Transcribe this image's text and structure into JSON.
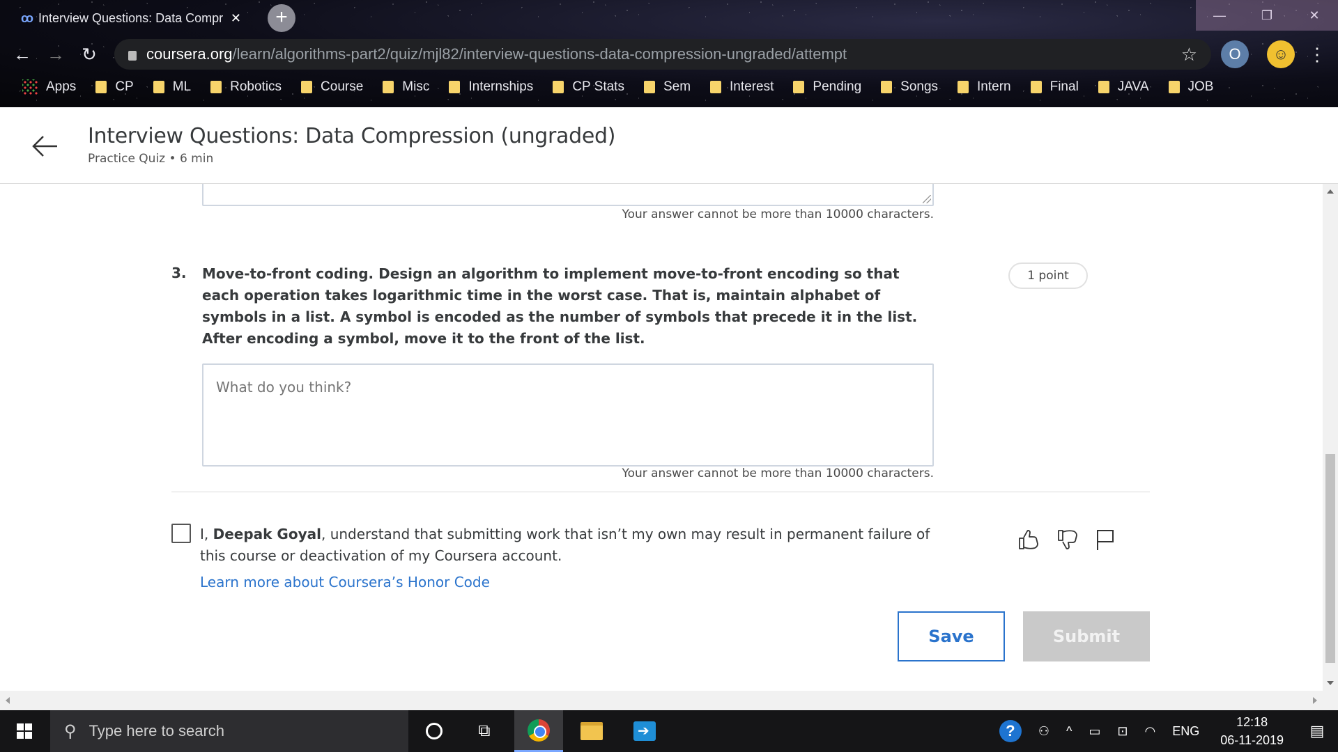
{
  "browser": {
    "tab_title": "Interview Questions: Data Compr",
    "tab_close": "✕",
    "url_host": "coursera.org",
    "url_path": "/learn/algorithms-part2/quiz/mjl82/interview-questions-data-compression-ungraded/attempt",
    "bookmarks": [
      "Apps",
      "CP",
      "ML",
      "Robotics",
      "Course",
      "Misc",
      "Internships",
      "CP Stats",
      "Sem",
      "Interest",
      "Pending",
      "Songs",
      "Intern",
      "Final",
      "JAVA",
      "JOB"
    ]
  },
  "header": {
    "title": "Interview Questions: Data Compression (ungraded)",
    "subtitle": "Practice Quiz • 6 min"
  },
  "quiz": {
    "char_limit_text": "Your answer cannot be more than 10000 characters.",
    "question": {
      "number": "3.",
      "text": "Move-to-front coding. Design an algorithm to implement move-to-front encoding so that each operation takes logarithmic time in the worst case. That is, maintain alphabet of symbols in a list. A symbol is encoded as the number of symbols that precede it in the list. After encoding a symbol, move it to the front of the list.",
      "points": "1 point",
      "placeholder": "What do you think?"
    },
    "honor": {
      "prefix": "I, ",
      "name": "Deepak Goyal",
      "suffix": ", understand that submitting work that isn’t my own may result in permanent failure of this course or deactivation of my Coursera account.",
      "link": "Learn more about Coursera’s Honor Code",
      "checked": false
    },
    "save_label": "Save",
    "submit_label": "Submit"
  },
  "taskbar": {
    "search_placeholder": "Type here to search",
    "language": "ENG",
    "time": "12:18",
    "date": "06-11-2019"
  },
  "colors": {
    "link": "#2a73cc",
    "submit_disabled": "#c9c9c9",
    "text": "#373a3c"
  }
}
